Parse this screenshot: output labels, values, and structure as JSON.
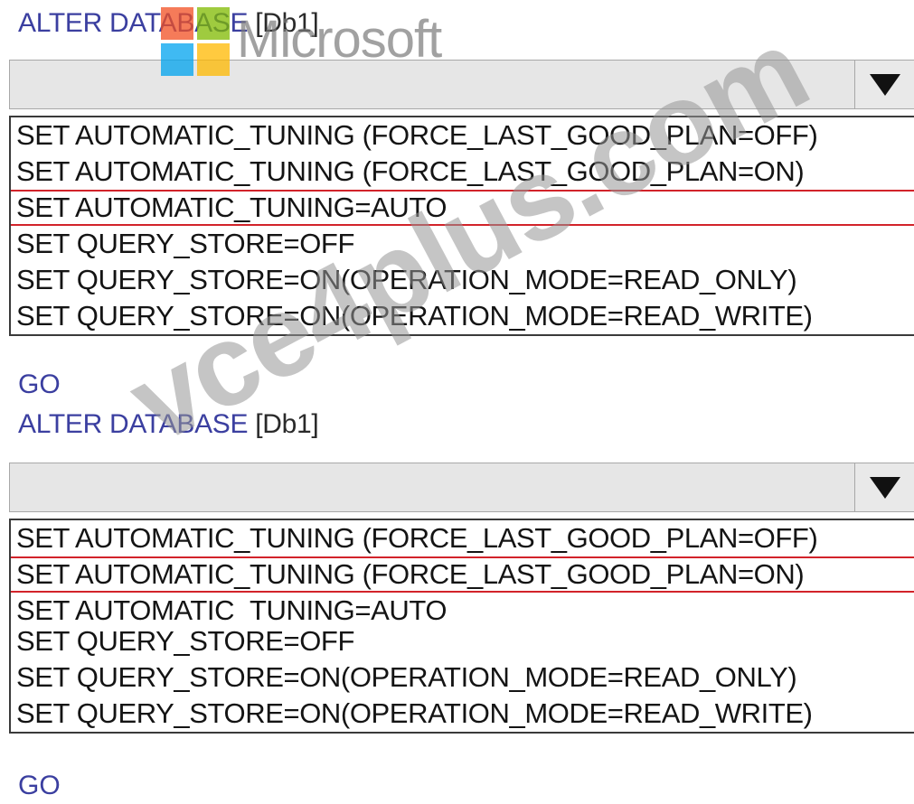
{
  "watermarks": {
    "microsoft_text": "Microsoft",
    "site_text": "vce4plus.com"
  },
  "blocks": [
    {
      "statement": "ALTER DATABASE",
      "db": "[Db1]",
      "dropdown_value": "",
      "options": [
        "SET AUTOMATIC_TUNING (FORCE_LAST_GOOD_PLAN=OFF)",
        "SET AUTOMATIC_TUNING (FORCE_LAST_GOOD_PLAN=ON)",
        "SET AUTOMATIC_TUNING=AUTO",
        "SET QUERY_STORE=OFF",
        "SET QUERY_STORE=ON(OPERATION_MODE=READ_ONLY)",
        "SET QUERY_STORE=ON(OPERATION_MODE=READ_WRITE)"
      ],
      "selected_option": "SET AUTOMATIC_TUNING=AUTO",
      "go": "GO"
    },
    {
      "statement": "ALTER DATABASE",
      "db": "[Db1]",
      "dropdown_value": "",
      "options": [
        "SET AUTOMATIC_TUNING (FORCE_LAST_GOOD_PLAN=OFF)",
        "SET AUTOMATIC_TUNING (FORCE_LAST_GOOD_PLAN=ON)",
        "SET AUTOMATIC_TUNING=AUTO",
        "SET QUERY_STORE=OFF",
        "SET QUERY_STORE=ON(OPERATION_MODE=READ_ONLY)",
        "SET QUERY_STORE=ON(OPERATION_MODE=READ_WRITE)"
      ],
      "selected_option": "SET AUTOMATIC_TUNING (FORCE_LAST_GOOD_PLAN=ON)",
      "go": "GO"
    }
  ],
  "colors": {
    "keyword": "#3b3fa0",
    "highlight": "#d2232a",
    "dropdown_bg": "#e6e6e6"
  },
  "icons": {
    "dropdown_arrow": "caret-down-icon",
    "logo": "microsoft-logo"
  }
}
